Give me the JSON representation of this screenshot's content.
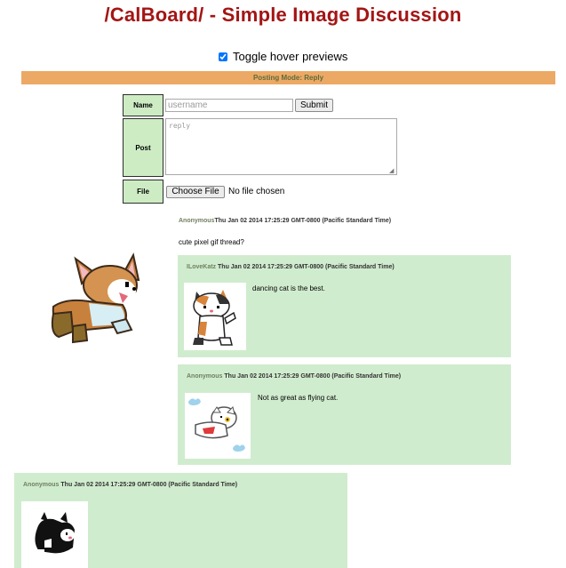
{
  "page": {
    "title": "/CalBoard/ - Simple Image Discussion",
    "toggle_label": "Toggle hover previews",
    "toggle_checked": true,
    "posting_mode": "Posting Mode: Reply"
  },
  "form": {
    "name_label": "Name",
    "name_placeholder": "username",
    "submit_label": "Submit",
    "post_label": "Post",
    "post_placeholder": "reply",
    "file_label": "File",
    "file_button": "Choose File",
    "file_status": "No file chosen"
  },
  "thread": {
    "op": {
      "author": "Anonymous",
      "date": "Thu Jan 02 2014 17:25:29 GMT-0800 (Pacific Standard Time)",
      "text": "cute pixel gif thread?",
      "image_icon": "corgi-pixel-image"
    },
    "replies": [
      {
        "author": "ILoveKatz",
        "date": "Thu Jan 02 2014 17:25:29 GMT-0800 (Pacific Standard Time)",
        "text": "dancing cat is the best.",
        "image_icon": "dancing-cat-image"
      },
      {
        "author": "Anonymous",
        "date": "Thu Jan 02 2014 17:25:29 GMT-0800 (Pacific Standard Time)",
        "text": "Not as great as flying cat.",
        "image_icon": "flying-cat-image"
      },
      {
        "author": "Anonymous",
        "date": "Thu Jan 02 2014 17:25:29 GMT-0800 (Pacific Standard Time)",
        "text": "",
        "image_icon": "black-cat-image"
      }
    ]
  },
  "colors": {
    "title": "#a31515",
    "banner": "#eca965",
    "reply_bg": "#d0ecce",
    "label_bg": "#cdecc4"
  }
}
